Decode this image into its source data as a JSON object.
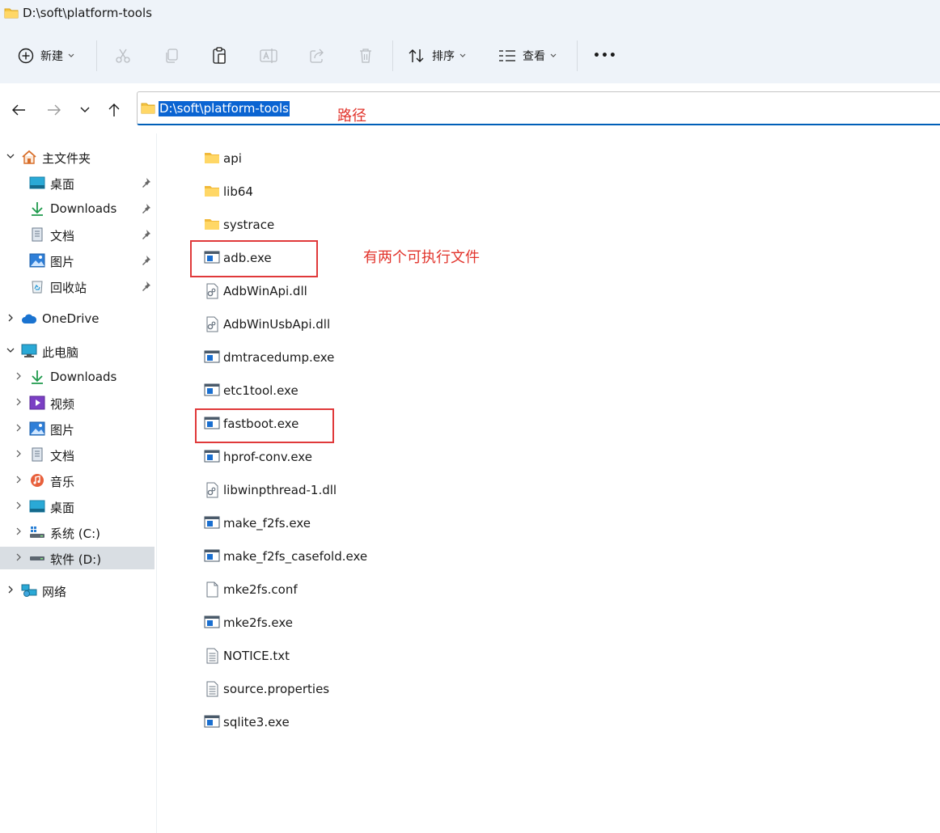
{
  "window": {
    "title": "D:\\soft\\platform-tools"
  },
  "toolbar": {
    "new_label": "新建",
    "sort_label": "排序",
    "view_label": "查看",
    "more_label": "•••"
  },
  "address": {
    "path": "D:\\soft\\platform-tools"
  },
  "annotations": {
    "path_note": "路径",
    "exe_note": "有两个可执行文件",
    "color": "#e2352d"
  },
  "sidebar": {
    "home": "主文件夹",
    "quick": [
      "桌面",
      "Downloads",
      "文档",
      "图片",
      "回收站"
    ],
    "onedrive": "OneDrive",
    "thispc": "此电脑",
    "pc_items": [
      "Downloads",
      "视频",
      "图片",
      "文档",
      "音乐",
      "桌面",
      "系统 (C:)",
      "软件 (D:)"
    ],
    "network": "网络",
    "selected": "软件 (D:)"
  },
  "files": [
    {
      "name": "api",
      "type": "folder"
    },
    {
      "name": "lib64",
      "type": "folder"
    },
    {
      "name": "systrace",
      "type": "folder"
    },
    {
      "name": "adb.exe",
      "type": "exe"
    },
    {
      "name": "AdbWinApi.dll",
      "type": "dll"
    },
    {
      "name": "AdbWinUsbApi.dll",
      "type": "dll"
    },
    {
      "name": "dmtracedump.exe",
      "type": "exe"
    },
    {
      "name": "etc1tool.exe",
      "type": "exe"
    },
    {
      "name": "fastboot.exe",
      "type": "exe"
    },
    {
      "name": "hprof-conv.exe",
      "type": "exe"
    },
    {
      "name": "libwinpthread-1.dll",
      "type": "dll"
    },
    {
      "name": "make_f2fs.exe",
      "type": "exe"
    },
    {
      "name": "make_f2fs_casefold.exe",
      "type": "exe"
    },
    {
      "name": "mke2fs.conf",
      "type": "file"
    },
    {
      "name": "mke2fs.exe",
      "type": "exe"
    },
    {
      "name": "NOTICE.txt",
      "type": "txt"
    },
    {
      "name": "source.properties",
      "type": "txt"
    },
    {
      "name": "sqlite3.exe",
      "type": "exe"
    }
  ],
  "colors": {
    "accent": "#005fb8",
    "selection": "#0a64d2",
    "chrome": "#eef3f9"
  }
}
